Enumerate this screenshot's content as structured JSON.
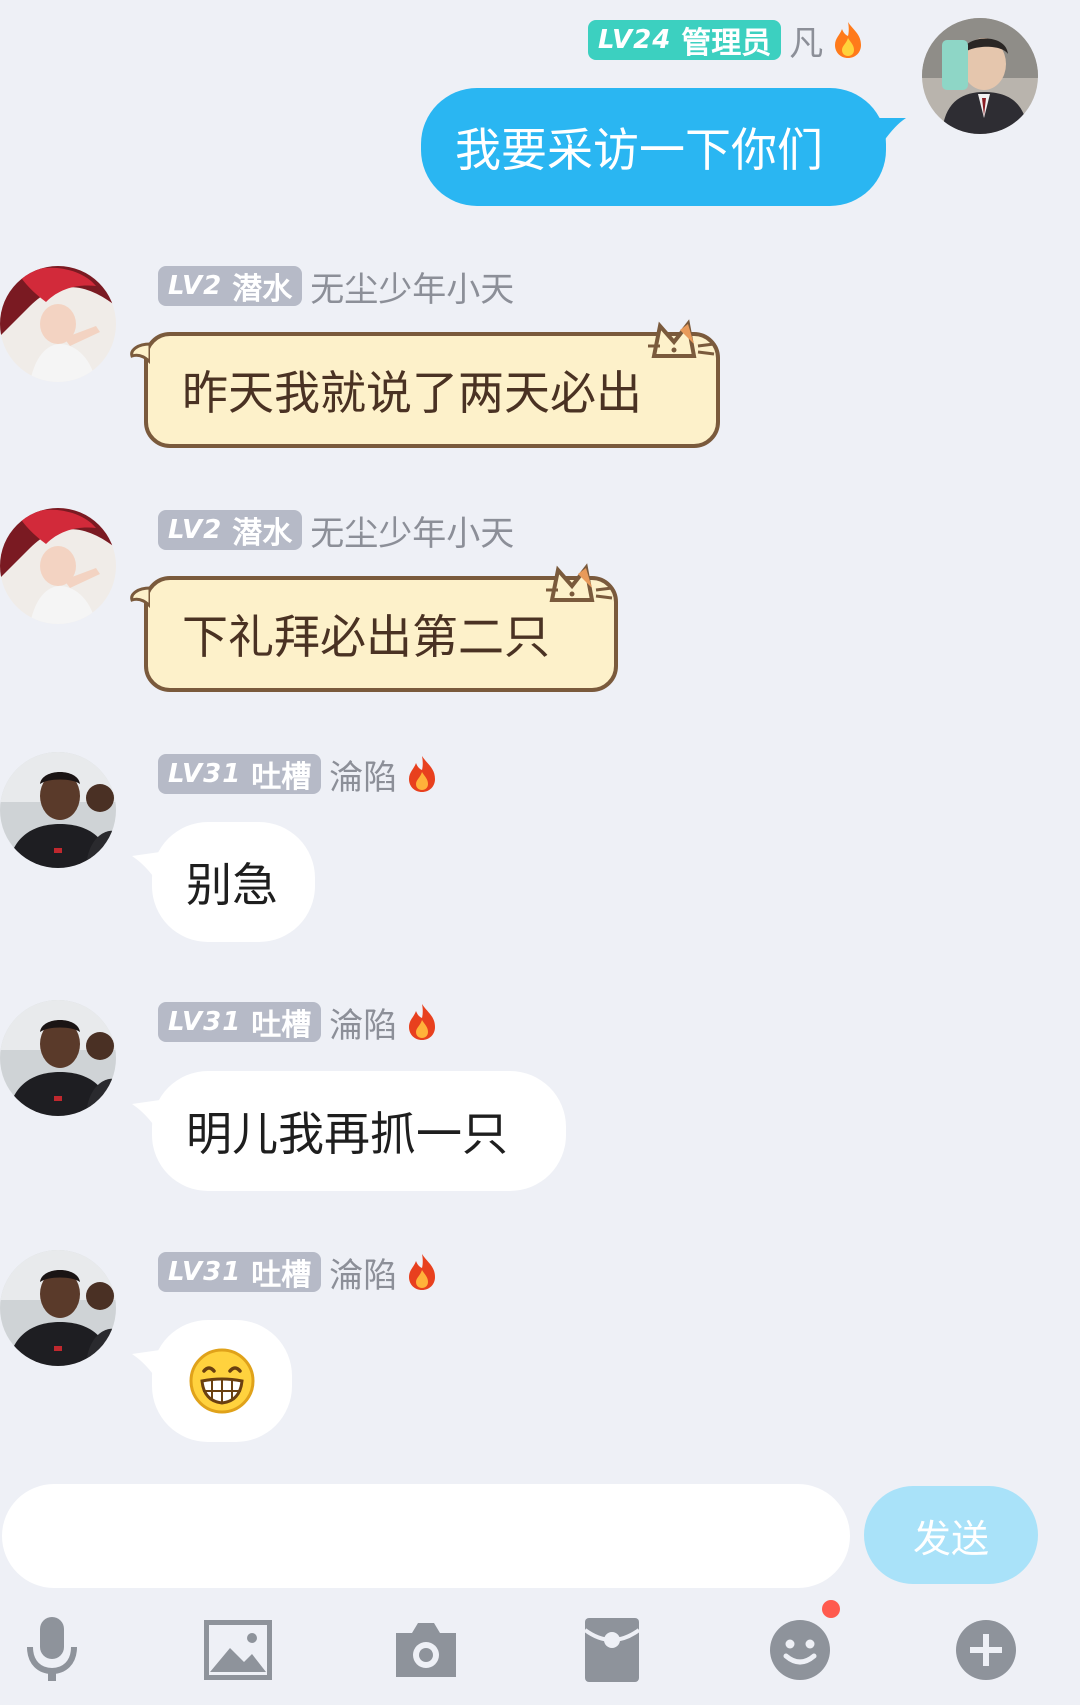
{
  "messages": [
    {
      "sender": "凡",
      "level": "LV24",
      "role": "管理员",
      "text": "我要采访一下你们",
      "mine": true
    },
    {
      "sender": "无尘少年小天",
      "level": "LV2",
      "role": "潜水",
      "text": "昨天我就说了两天必出"
    },
    {
      "sender": "无尘少年小天",
      "level": "LV2",
      "role": "潜水",
      "text": "下礼拜必出第二只"
    },
    {
      "sender": "淪陷",
      "level": "LV31",
      "role": "吐槽",
      "text": "别急"
    },
    {
      "sender": "淪陷",
      "level": "LV31",
      "role": "吐槽",
      "text": "明儿我再抓一只"
    },
    {
      "sender": "淪陷",
      "level": "LV31",
      "role": "吐槽",
      "emoji": "grinning-face-icon"
    }
  ],
  "composer": {
    "placeholder": "",
    "send_label": "发送"
  },
  "toolbar": [
    "microphone-icon",
    "image-icon",
    "camera-icon",
    "red-packet-icon",
    "emoji-icon",
    "plus-icon"
  ],
  "colors": {
    "my_bubble": "#2ab6f2",
    "background": "#eef0f6",
    "send_button": "#a9e2f9",
    "admin_badge": "#3cd0c0",
    "member_badge": "#b6bac7",
    "notification_dot": "#ff5a4e"
  }
}
